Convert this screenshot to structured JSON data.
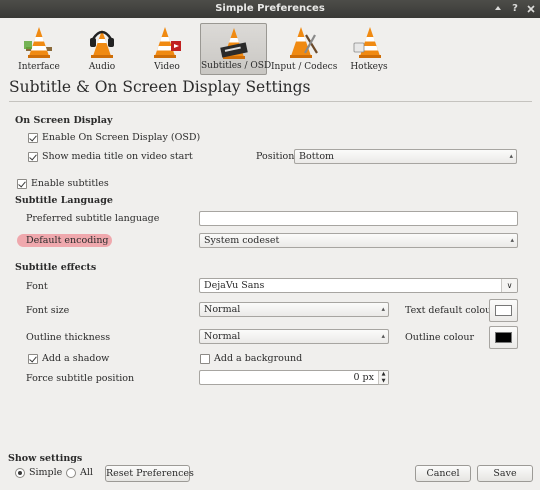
{
  "window": {
    "title": "Simple Preferences"
  },
  "toolbar": {
    "items": [
      {
        "label": "Interface",
        "icon": "interface-cone-icon"
      },
      {
        "label": "Audio",
        "icon": "audio-headphones-cone-icon"
      },
      {
        "label": "Video",
        "icon": "video-cone-icon"
      },
      {
        "label": "Subtitles / OSD",
        "icon": "subtitles-cone-icon"
      },
      {
        "label": "Input / Codecs",
        "icon": "input-codecs-cone-icon"
      },
      {
        "label": "Hotkeys",
        "icon": "hotkeys-cone-icon"
      }
    ],
    "active": "Subtitles / OSD"
  },
  "page": {
    "heading": "Subtitle & On Screen Display Settings"
  },
  "osd": {
    "group_title": "On Screen Display",
    "enable_osd": {
      "label": "Enable On Screen Display (OSD)",
      "checked": true
    },
    "show_title": {
      "label": "Show media title on video start",
      "checked": true
    },
    "position_label": "Position",
    "position_value": "Bottom"
  },
  "enable_subtitles": {
    "label": "Enable subtitles",
    "checked": true
  },
  "subtitle_language": {
    "group_title": "Subtitle Language",
    "preferred_label": "Preferred subtitle language",
    "preferred_value": "",
    "encoding_label": "Default encoding",
    "encoding_value": "System codeset"
  },
  "effects": {
    "group_title": "Subtitle effects",
    "font_label": "Font",
    "font_value": "DejaVu Sans",
    "font_size_label": "Font size",
    "font_size_value": "Normal",
    "text_colour_label": "Text default colour",
    "text_colour": "#ffffff",
    "outline_thickness_label": "Outline thickness",
    "outline_thickness_value": "Normal",
    "outline_colour_label": "Outline colour",
    "outline_colour": "#000000",
    "shadow": {
      "label": "Add a shadow",
      "checked": true
    },
    "background": {
      "label": "Add a background",
      "checked": false
    },
    "force_position_label": "Force subtitle position",
    "force_position_value": "0 px"
  },
  "footer": {
    "show_settings_label": "Show settings",
    "simple_label": "Simple",
    "all_label": "All",
    "selected": "Simple",
    "reset_label": "Reset Preferences",
    "cancel_label": "Cancel",
    "save_label": "Save"
  }
}
